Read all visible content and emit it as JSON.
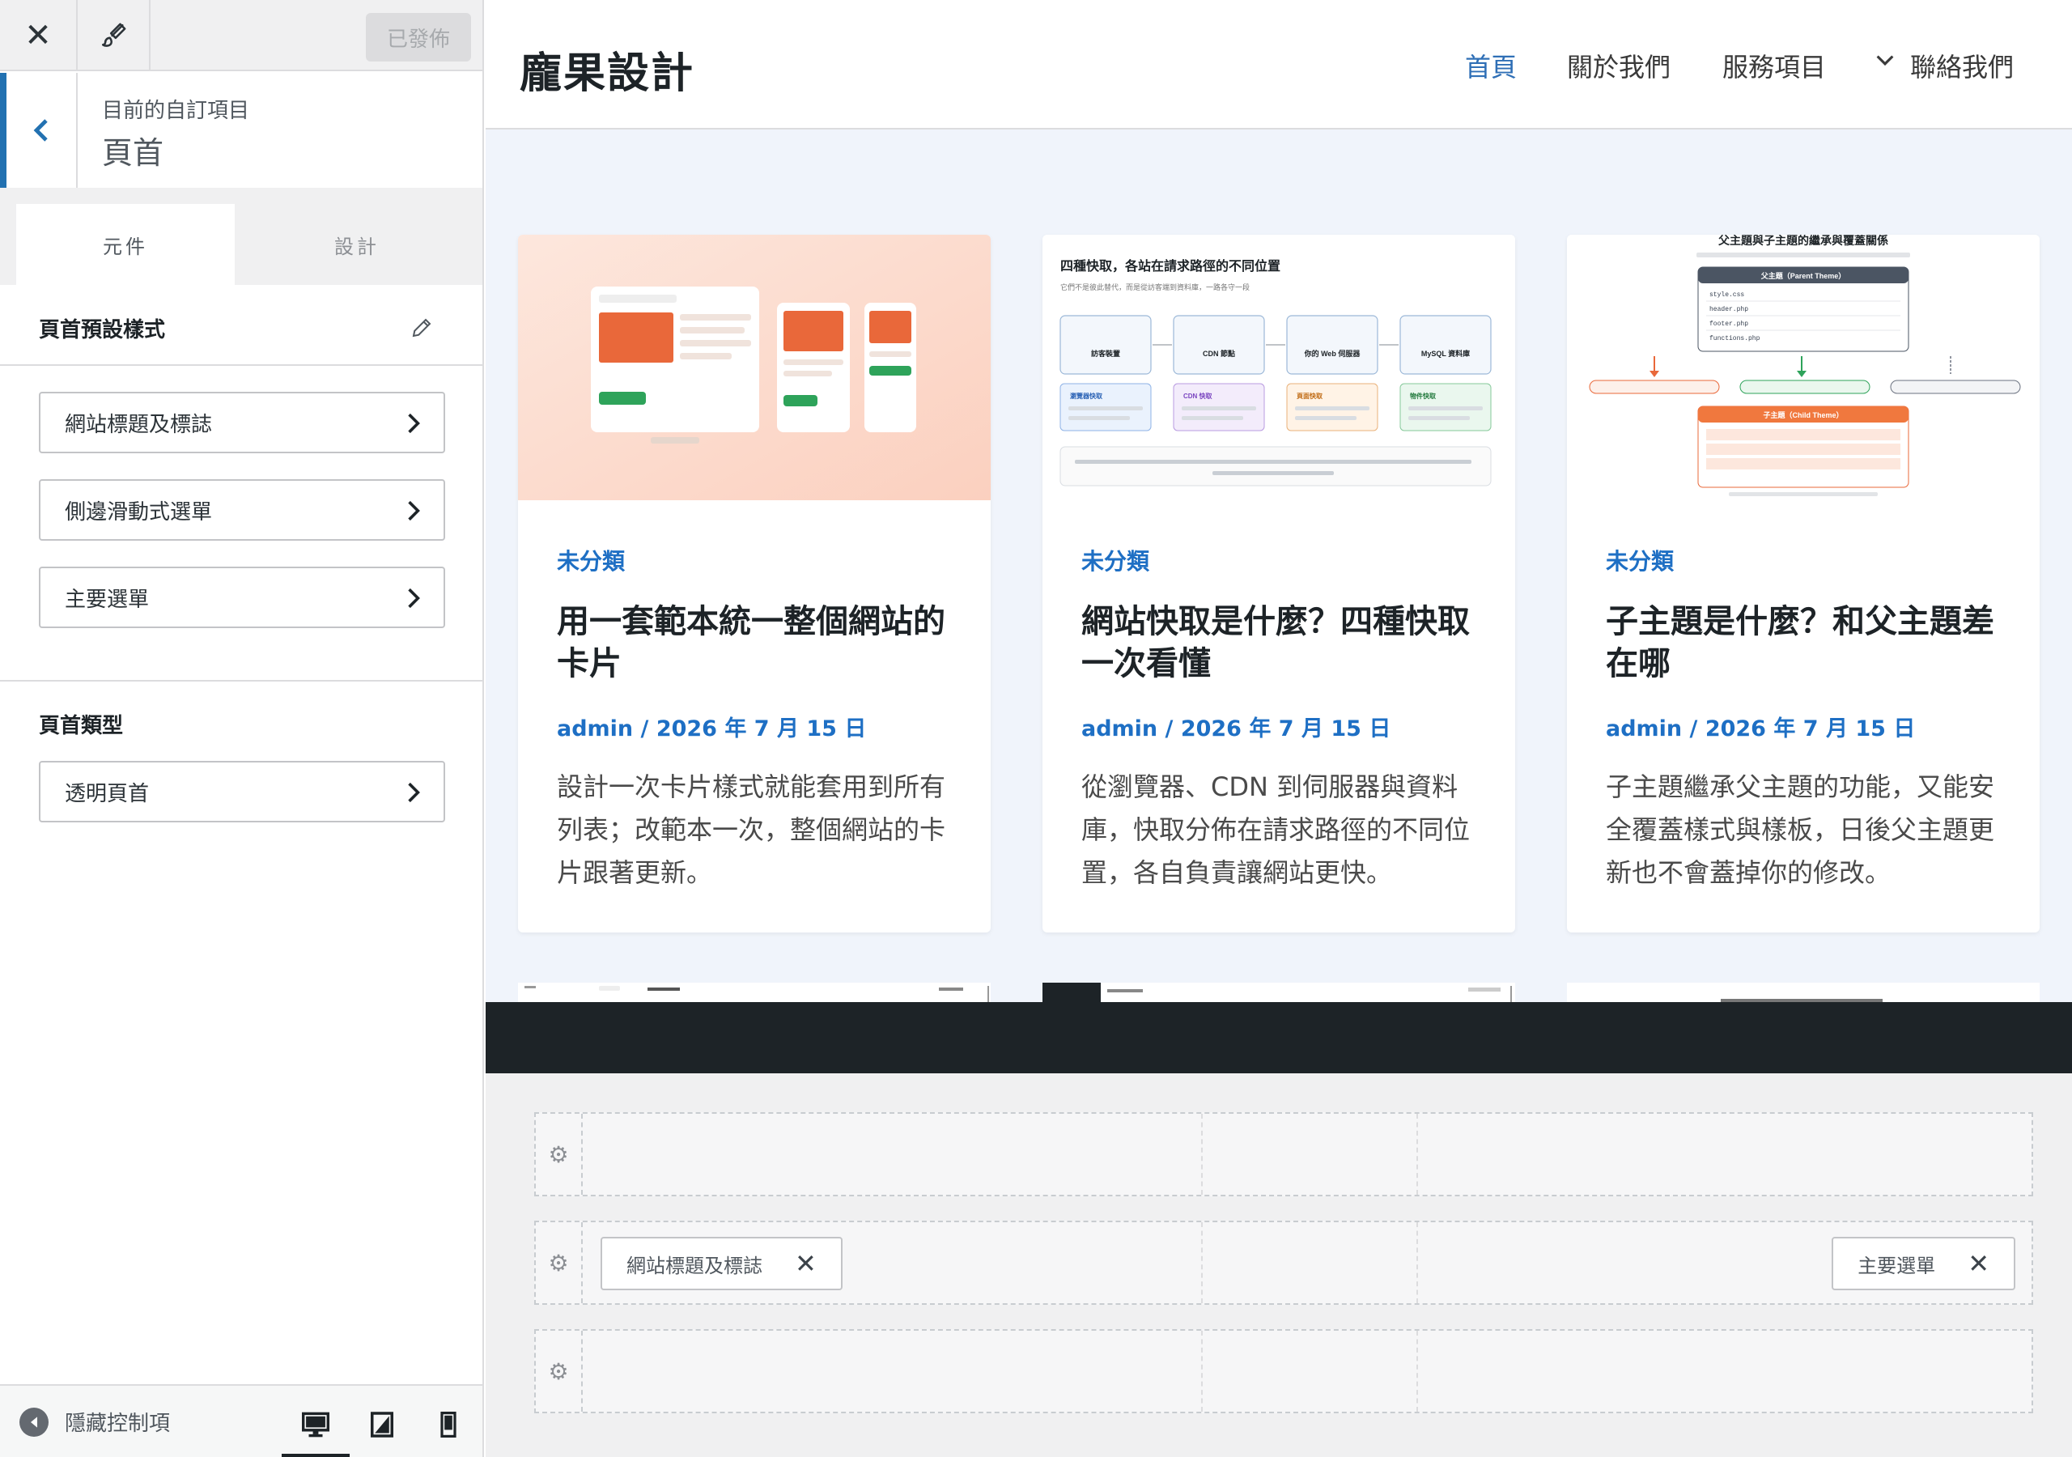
{
  "topbar": {
    "publish_label": "已發佈"
  },
  "section": {
    "subtitle": "目前的自訂項目",
    "title": "頁首"
  },
  "tabs": [
    {
      "label": "元件"
    },
    {
      "label": "設計"
    }
  ],
  "group1": {
    "title": "頁首預設樣式",
    "items": [
      {
        "label": "網站標題及標誌"
      },
      {
        "label": "側邊滑動式選單"
      },
      {
        "label": "主要選單"
      }
    ]
  },
  "group2": {
    "title": "頁首類型",
    "items": [
      {
        "label": "透明頁首"
      }
    ]
  },
  "footer": {
    "hide_controls": "隱藏控制項"
  },
  "site": {
    "title": "龐果設計",
    "menu": [
      {
        "label": "首頁"
      },
      {
        "label": "關於我們"
      },
      {
        "label": "服務項目"
      },
      {
        "label": "聯絡我們"
      }
    ]
  },
  "posts": [
    {
      "category": "未分類",
      "title": "用一套範本統一整個網站的卡片",
      "meta": "admin / 2026 年 7 月 15 日",
      "excerpt": "設計一次卡片樣式就能套用到所有列表；改範本一次，整個網站的卡片跟著更新。"
    },
    {
      "category": "未分類",
      "title": "網站快取是什麼？四種快取一次看懂",
      "meta": "admin / 2026 年 7 月 15 日",
      "excerpt": "從瀏覽器、CDN 到伺服器與資料庫，快取分佈在請求路徑的不同位置，各自負責讓網站更快。",
      "thumb": {
        "heading": "四種快取，各站在請求路徑的不同位置",
        "sub": "它們不是彼此替代，而是從訪客端到資料庫，一路各守一段",
        "nodes": [
          "訪客裝置",
          "CDN 節點",
          "你的 Web 伺服器",
          "MySQL 資料庫"
        ],
        "caches": [
          "瀏覽器快取",
          "CDN 快取",
          "頁面快取",
          "物件快取"
        ]
      }
    },
    {
      "category": "未分類",
      "title": "子主題是什麼？和父主題差在哪",
      "meta": "admin / 2026 年 7 月 15 日",
      "excerpt": "子主題繼承父主題的功能，又能安全覆蓋樣式與樣板，日後父主題更新也不會蓋掉你的修改。",
      "thumb": {
        "heading": "父主題與子主題的繼承與覆蓋關係",
        "parent": "父主題（Parent Theme）",
        "child": "子主題（Child Theme）",
        "files": [
          "style.css",
          "header.php",
          "footer.php",
          "functions.php"
        ]
      }
    }
  ],
  "builder": {
    "chip_logo": "網站標題及標誌",
    "chip_menu": "主要選單"
  },
  "colors": {
    "accent": "#2271b1",
    "link": "#1e6fc4",
    "dark_bar": "#1d2327"
  }
}
